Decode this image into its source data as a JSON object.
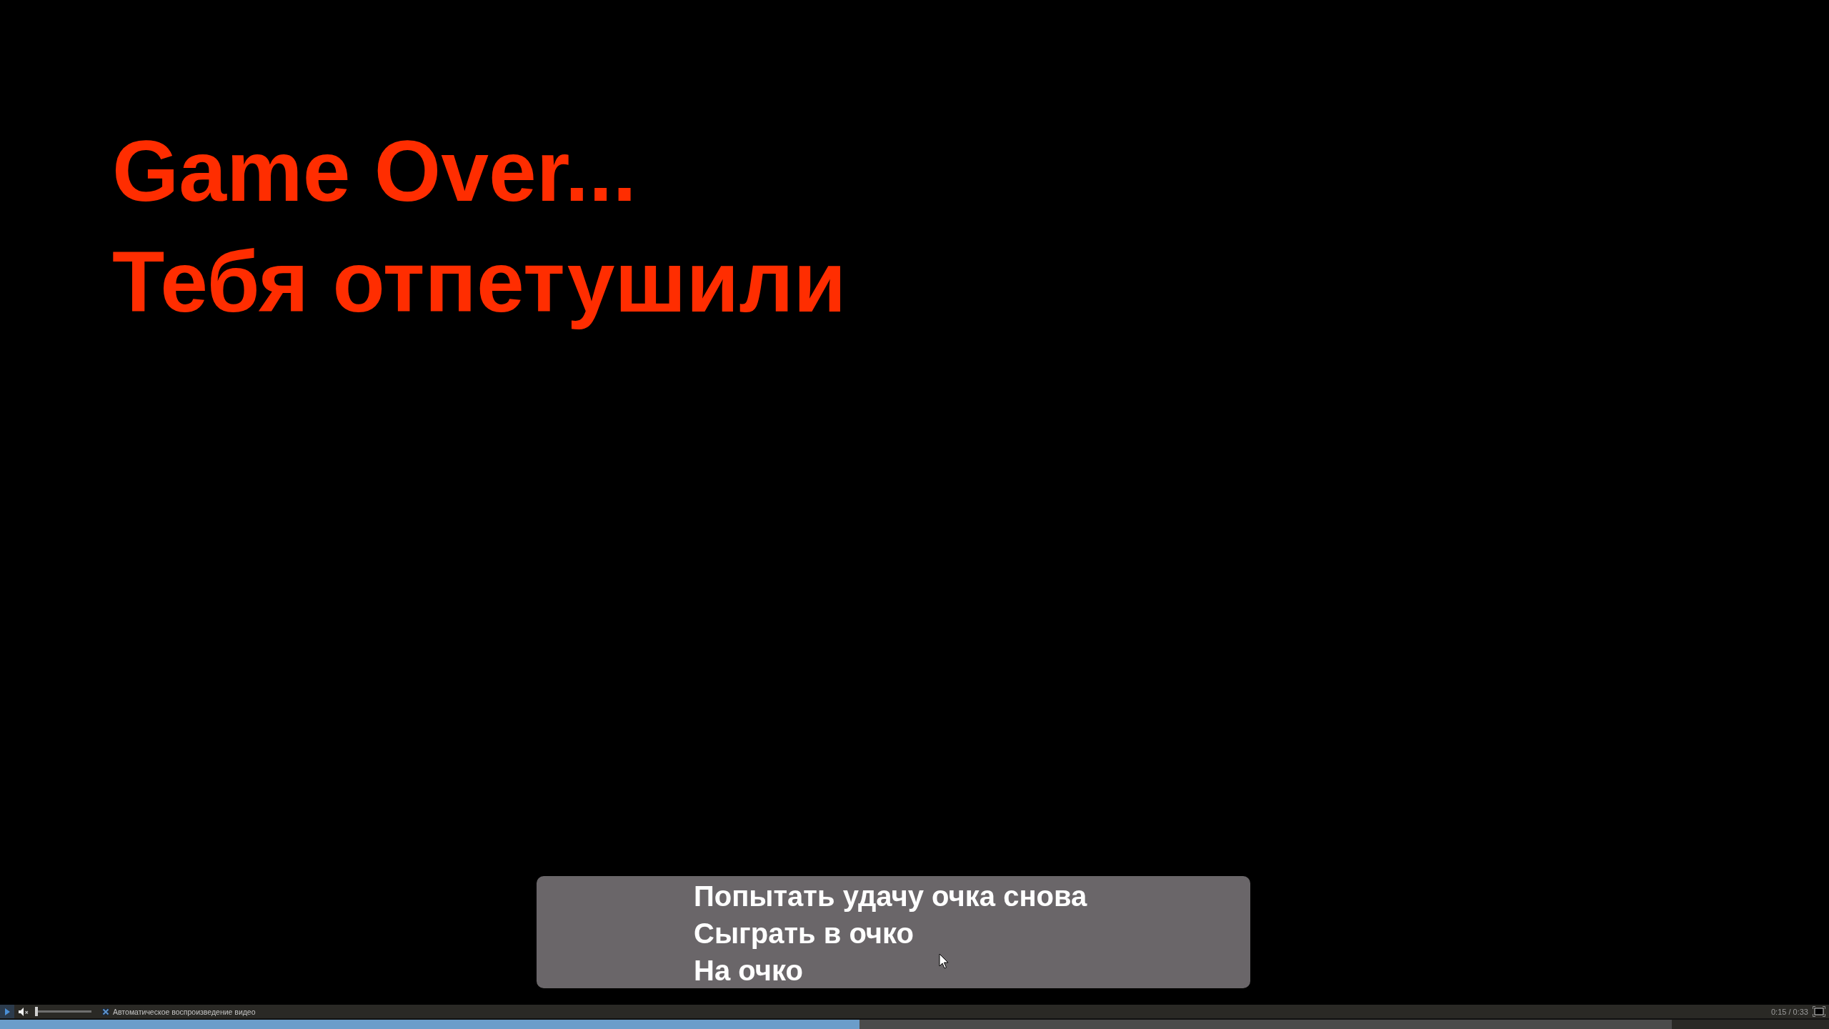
{
  "game_screen": {
    "heading_lines": [
      "Game Over...",
      "Тебя отпетушили"
    ],
    "menu": [
      {
        "label": "Попытать удачу очка снова",
        "selected": false
      },
      {
        "label": "Сыграть в очко",
        "selected": false
      },
      {
        "label": "На очко",
        "selected": false
      }
    ]
  },
  "player": {
    "playing": false,
    "muted": true,
    "volume": {
      "level": 0
    },
    "autoplay": {
      "label": "Автоматическое воспроизведение видео",
      "checked": true
    },
    "time": "0:15 / 0:33",
    "buffer": {
      "level": 0.914
    },
    "progress": {
      "level": 0.47
    }
  }
}
